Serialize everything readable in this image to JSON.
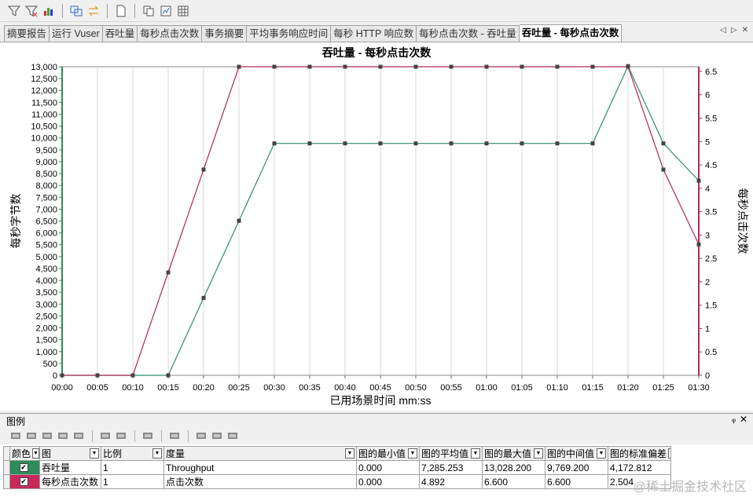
{
  "tabs": [
    {
      "label": "摘要报告"
    },
    {
      "label": "运行 Vuser"
    },
    {
      "label": "吞吐量"
    },
    {
      "label": "每秒点击次数"
    },
    {
      "label": "事务摘要"
    },
    {
      "label": "平均事务响应时间"
    },
    {
      "label": "每秒 HTTP 响应数"
    },
    {
      "label": "每秒点击次数 - 吞吐量"
    },
    {
      "label": "吞吐量 - 每秒点击次数",
      "active": true
    }
  ],
  "tab_nav": {
    "prev": "◁",
    "next": "▷",
    "close": "✕"
  },
  "toolbar_icons": [
    "filter-icon",
    "filter-clear-icon",
    "merge-graphs-icon",
    "compare-icon",
    "swap-icon",
    "page-icon",
    "copy-icon",
    "export-icon",
    "grid-icon"
  ],
  "chart_data": {
    "type": "line",
    "title": "吞吐量 - 每秒点击次数",
    "xlabel": "已用场景时间 mm:ss",
    "ylabel": "每秒字节数",
    "y2label": "每秒点击次数",
    "x": [
      "00:00",
      "00:05",
      "00:10",
      "00:15",
      "00:20",
      "00:25",
      "00:30",
      "00:35",
      "00:40",
      "00:45",
      "00:50",
      "00:55",
      "01:00",
      "01:05",
      "01:10",
      "01:15",
      "01:20",
      "01:25",
      "01:30"
    ],
    "ylim": [
      0,
      13000
    ],
    "y2lim": [
      0,
      6.6
    ],
    "yticks": [
      "0",
      "500",
      "1,000",
      "1,500",
      "2,000",
      "2,500",
      "3,000",
      "3,500",
      "4,000",
      "4,500",
      "5,000",
      "5,500",
      "6,000",
      "6,500",
      "7,000",
      "7,500",
      "8,000",
      "8,500",
      "9,000",
      "9,500",
      "10,000",
      "10,500",
      "11,000",
      "11,500",
      "12,000",
      "12,500",
      "13,000"
    ],
    "y2ticks": [
      "0",
      "0.5",
      "1",
      "1.5",
      "2",
      "2.5",
      "3",
      "3.5",
      "4",
      "4.5",
      "5",
      "5.5",
      "6",
      "6.5"
    ],
    "series": [
      {
        "name": "吞吐量",
        "axis": "left",
        "color": "#2e8b72",
        "values": [
          0,
          0,
          0,
          0,
          3260,
          6510,
          9769,
          9769,
          9769,
          9769,
          9769,
          9769,
          9769,
          9769,
          9769,
          9769,
          13028,
          9769,
          8200
        ]
      },
      {
        "name": "每秒点击次数",
        "axis": "right",
        "color": "#b0285a",
        "values": [
          0,
          0,
          0,
          2.2,
          4.4,
          6.6,
          6.6,
          6.6,
          6.6,
          6.6,
          6.6,
          6.6,
          6.6,
          6.6,
          6.6,
          6.6,
          6.6,
          4.4,
          2.8
        ]
      }
    ]
  },
  "legend": {
    "title": "图例",
    "pin": "ᵩ",
    "close": "✕",
    "tool_icons": [
      "config-icon",
      "show-icon",
      "hide-icon",
      "link-icon",
      "filter-icon",
      "arrange-icon",
      "arrange-icon-2",
      "sort-icon",
      "columns-icon",
      "format-icon",
      "format-icon-2",
      "format-icon-3"
    ],
    "columns": [
      "颜色",
      "图",
      "比例",
      "度量",
      "图的最小值",
      "图的平均值",
      "图的最大值",
      "图的中间值",
      "图的标准偏差"
    ],
    "rows": [
      {
        "color": "#2e8b5c",
        "checked": "✔",
        "graph": "吞吐量",
        "scale": "1",
        "measure": "Throughput",
        "min": "0.000",
        "avg": "7,285.253",
        "max": "13,028.200",
        "median": "9,769.200",
        "std": "4,172.812"
      },
      {
        "color": "#c8285a",
        "checked": "✔",
        "graph": "每秒点击次数",
        "scale": "1",
        "measure": "点击次数",
        "min": "0.000",
        "avg": "4.892",
        "max": "6.600",
        "median": "6.600",
        "std": "2.504"
      }
    ]
  },
  "watermark": "@稀土掘金技术社区"
}
